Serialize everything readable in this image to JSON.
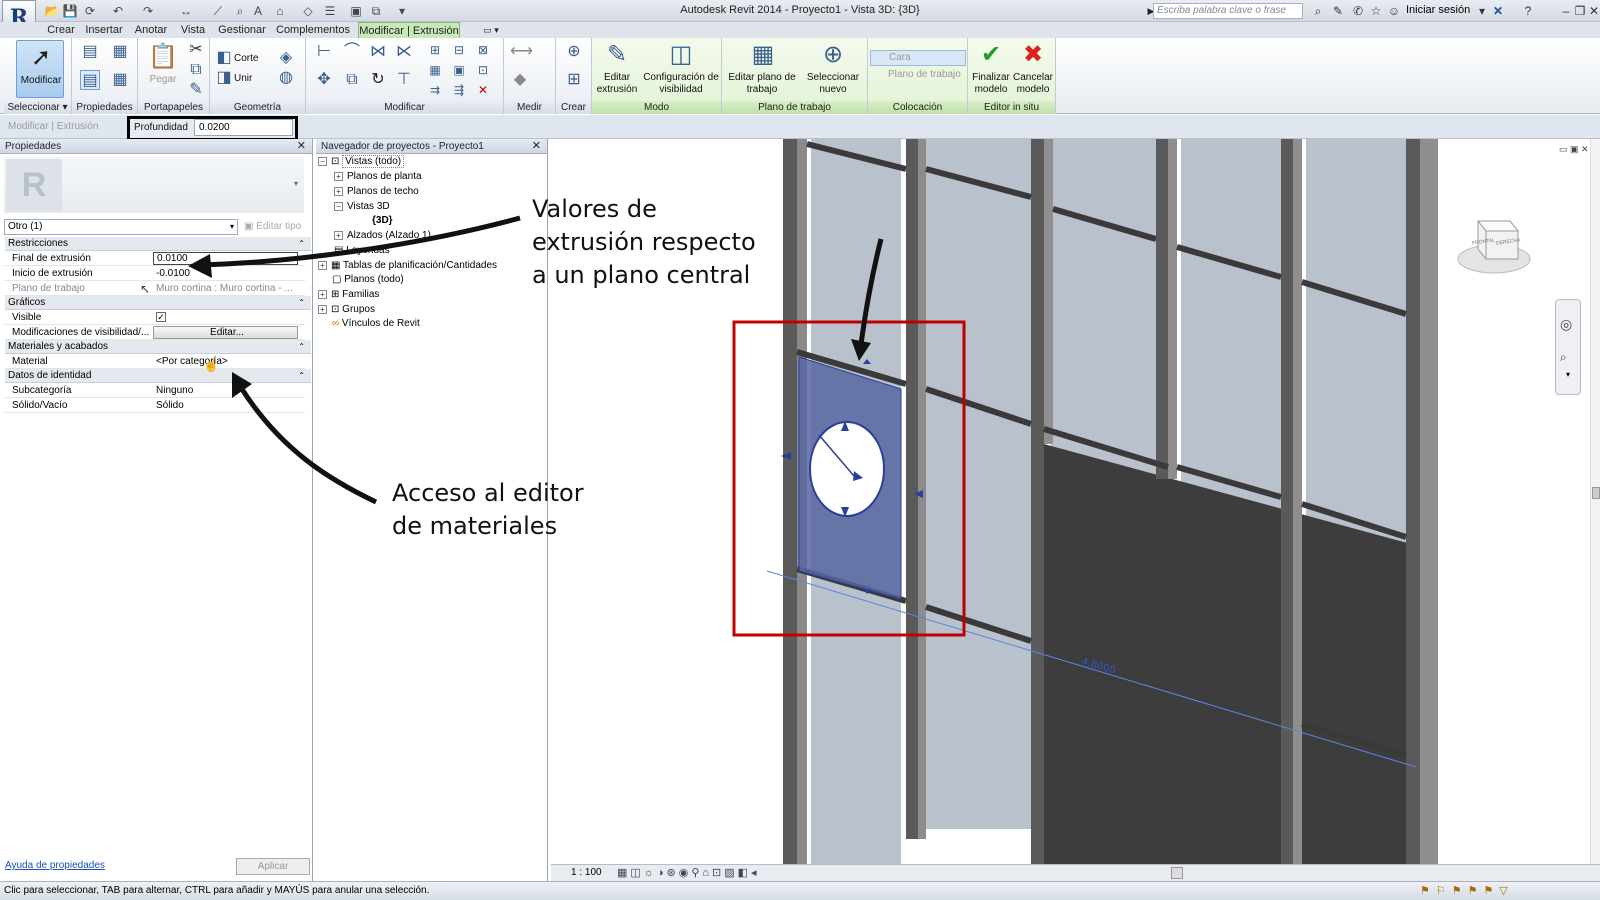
{
  "titlebar": {
    "title": "Autodesk Revit 2014 -    Proyecto1 - Vista 3D: {3D}",
    "search_placeholder": "Escriba palabra clave o frase",
    "signin": "Iniciar sesión",
    "app_letter": "R"
  },
  "tabs": [
    "Crear",
    "Insertar",
    "Anotar",
    "Vista",
    "Gestionar",
    "Complementos",
    "Modificar | Extrusión"
  ],
  "ribbon": {
    "modificar_label": "Modificar",
    "seleccionar_label": "Seleccionar",
    "propiedades_label": "Propiedades",
    "pegar_label": "Pegar",
    "portapapeles_label": "Portapapeles",
    "corte_label": "Corte",
    "unir_label": "Unir",
    "geometria_label": "Geometría",
    "modificar_panel_label": "Modificar",
    "medir_label": "Medir",
    "crear_label": "Crear",
    "editar_extrusion_label": "Editar extrusión",
    "config_visibilidad_label": "Configuración de visibilidad",
    "modo_label": "Modo",
    "editar_plano_label": "Editar plano de trabajo",
    "seleccionar_nuevo_label": "Seleccionar nuevo",
    "plano_trabajo_panel_label": "Plano de trabajo",
    "cara_label": "Cara",
    "plano_trabajo_btn_label": "Plano de trabajo",
    "colocacion_label": "Colocación",
    "finalizar_label": "Finalizar modelo",
    "cancelar_label": "Cancelar modelo",
    "editor_label": "Editor in situ"
  },
  "optionsbar": {
    "context": "Modificar | Extrusión",
    "depth_label": "Profundidad",
    "depth_value": "0.0200"
  },
  "properties": {
    "title": "Propiedades",
    "type_selector": "Otro (1)",
    "edit_type": "Editar tipo",
    "groups": {
      "restricciones": "Restricciones",
      "graficos": "Gráficos",
      "materiales": "Materiales y acabados",
      "identidad": "Datos de identidad"
    },
    "rows": {
      "final_k": "Final de extrusión",
      "final_v": "0.0100",
      "inicio_k": "Inicio de extrusión",
      "inicio_v": "-0.0100",
      "plano_k": "Plano de trabajo",
      "plano_v": "Muro cortina : Muro cortina - ...",
      "visible_k": "Visible",
      "visible_v": "✓",
      "modvis_k": "Modificaciones de visibilidad/...",
      "modvis_v": "Editar...",
      "material_k": "Material",
      "material_v": "<Por categoría>",
      "subcat_k": "Subcategoría",
      "subcat_v": "Ninguno",
      "solido_k": "Sólido/Vacío",
      "solido_v": "Sólido"
    },
    "help_link": "Ayuda de propiedades",
    "apply": "Aplicar"
  },
  "browser": {
    "title": "Navegador de proyectos - Proyecto1",
    "items": {
      "vistas": "Vistas (todo)",
      "planta": "Planos de planta",
      "techo": "Planos de techo",
      "vistas3d": "Vistas 3D",
      "v3d": "{3D}",
      "alzados": "Alzados (Alzado 1)",
      "leyendas": "Leyendas",
      "tablas": "Tablas de planificación/Cantidades",
      "planos": "Planos (todo)",
      "familias": "Familias",
      "grupos": "Grupos",
      "vinculos": "Vínculos de Revit"
    }
  },
  "viewport": {
    "dimension": "4.8000",
    "viewcube_front": "FRONTAL",
    "viewcube_right": "DERECHA"
  },
  "viewbar": {
    "scale": "1 : 100"
  },
  "annotations": {
    "a1_l1": "Valores de",
    "a1_l2": "extrusión respecto",
    "a1_l3": "a un plano central",
    "a2_l1": "Acceso al editor",
    "a2_l2": "de materiales"
  },
  "status": "Clic para seleccionar, TAB para alternar, CTRL para añadir y MAYÚS para anular una selección.",
  "colors": {
    "tab_active": "#c9e8b8",
    "highlight_red": "#c00000",
    "selection_blue": "#3050b0"
  }
}
